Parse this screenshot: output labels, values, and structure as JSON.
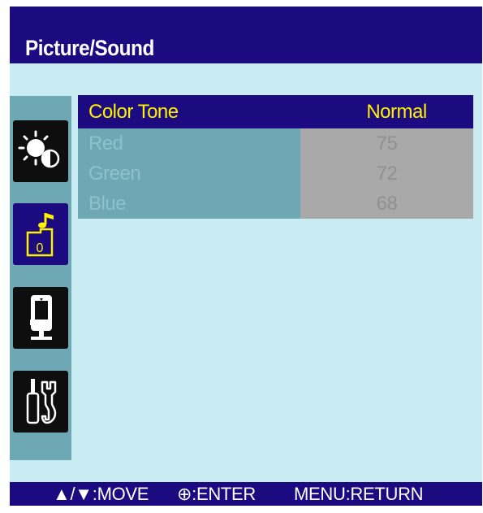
{
  "header": {
    "title": "Picture/Sound"
  },
  "sidebar": {
    "items": [
      {
        "name": "picture",
        "icon": "brightness-contrast-icon",
        "selected": false
      },
      {
        "name": "sound",
        "icon": "music-note-icon",
        "selected": true
      },
      {
        "name": "setup",
        "icon": "monitor-stand-icon",
        "selected": false
      },
      {
        "name": "tools",
        "icon": "screwdriver-wrench-icon",
        "selected": false
      }
    ]
  },
  "settings": {
    "color_tone": {
      "label": "Color Tone",
      "value": "Normal"
    },
    "red": {
      "label": "Red",
      "value": "75"
    },
    "green": {
      "label": "Green",
      "value": "72"
    },
    "blue": {
      "label": "Blue",
      "value": "68"
    }
  },
  "footer": {
    "move_hint": "▲/▼:MOVE",
    "enter_hint": "⊕:ENTER",
    "return_hint": "MENU:RETURN"
  },
  "colors": {
    "osd_background": "#c9ebf2",
    "title_bar": "#1c0a80",
    "highlight_text": "#fff200",
    "disabled_label": "#6ea8b4",
    "disabled_value": "#a9a9a9"
  }
}
